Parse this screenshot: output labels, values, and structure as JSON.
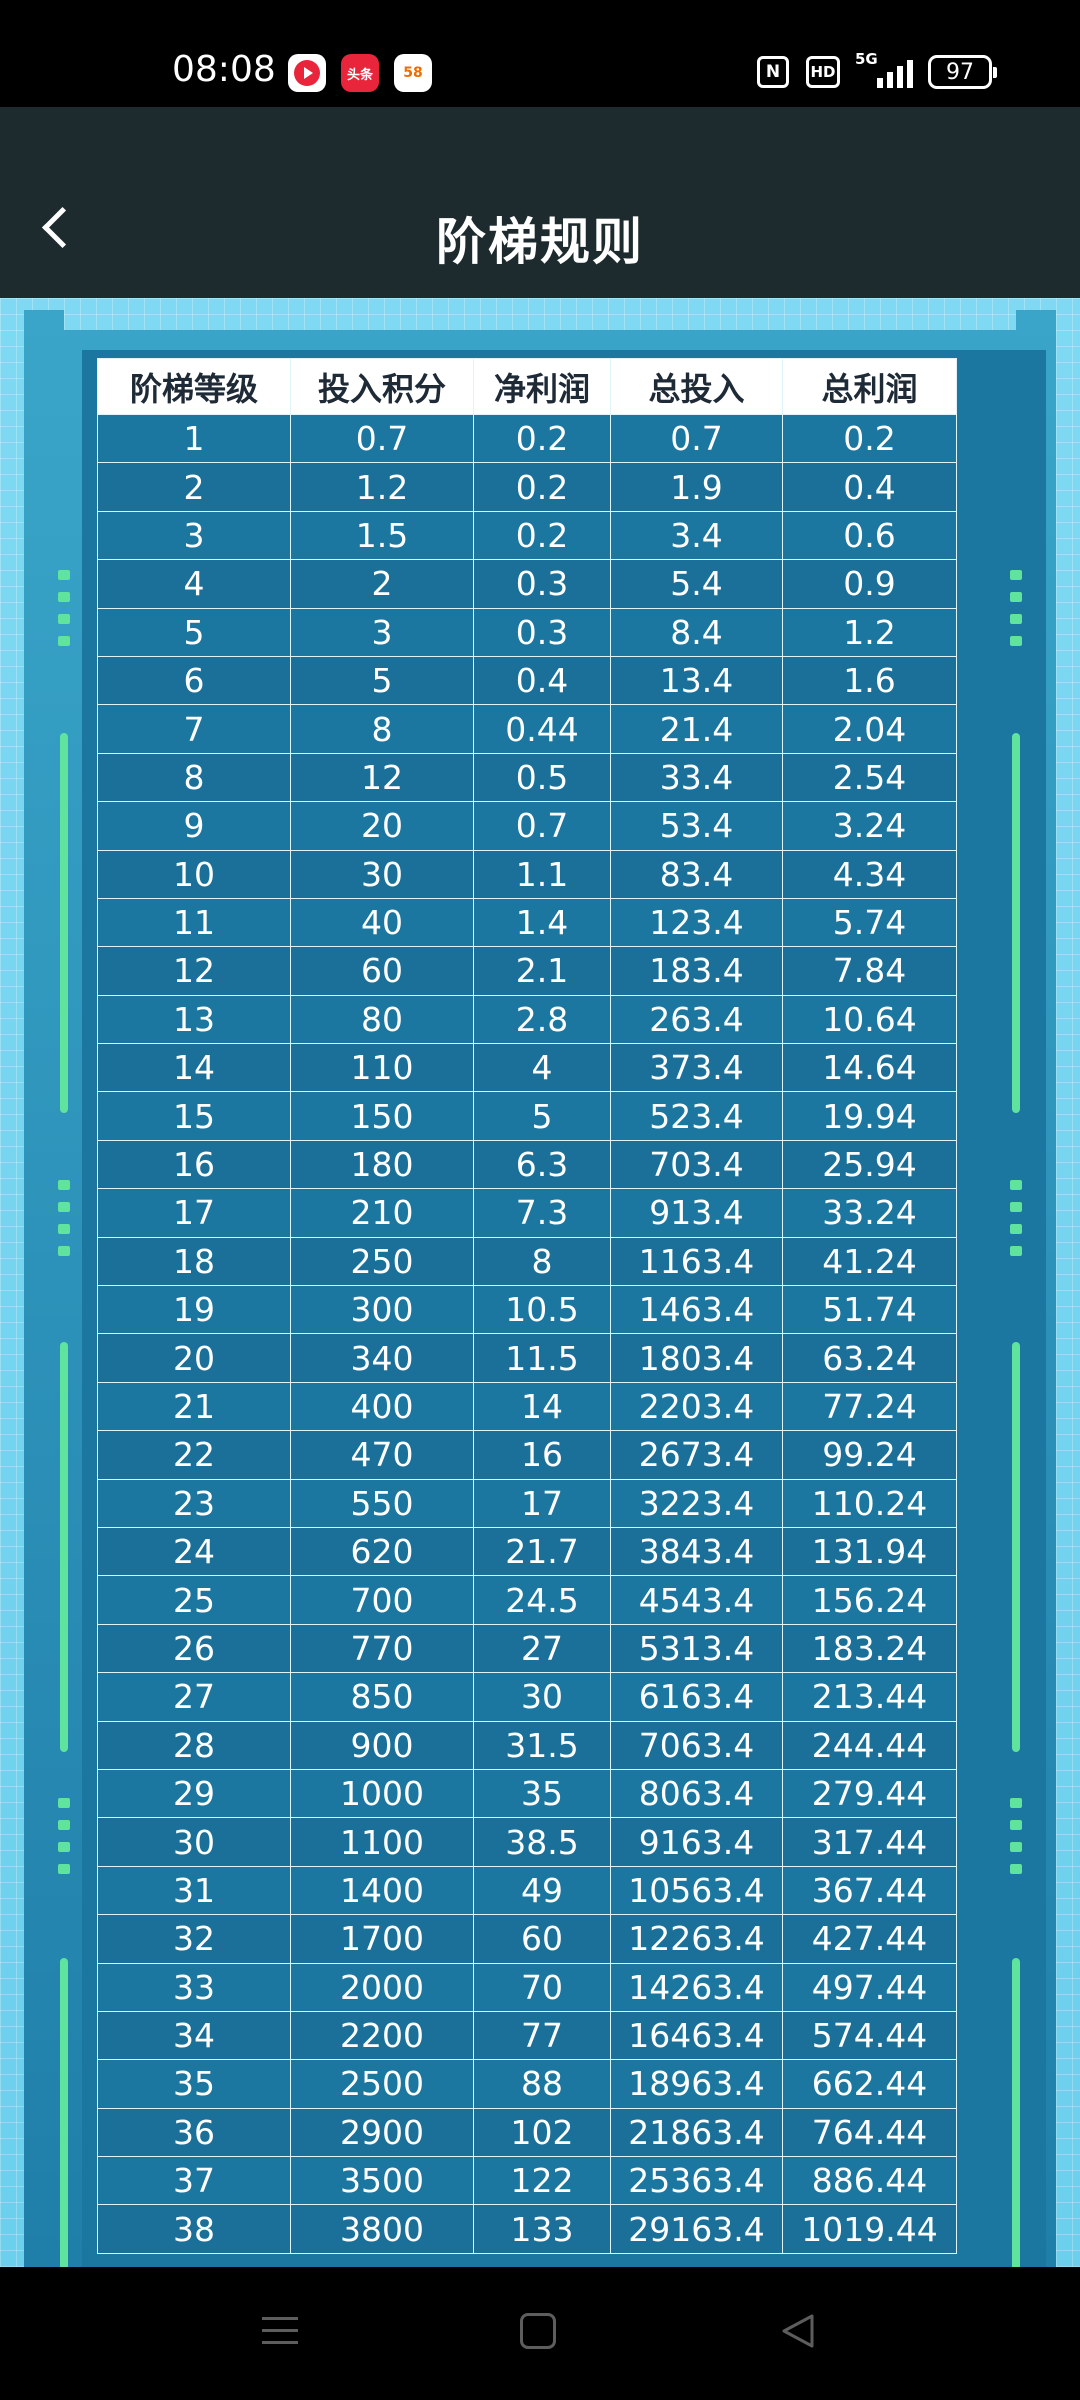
{
  "status_bar": {
    "time": "08:08",
    "notification_icons": [
      "video-app-icon",
      "toutiao-app-icon",
      "58-app-icon"
    ],
    "notif_2_text": "头条",
    "notif_3_text": "58",
    "nfc_text": "N",
    "hd_text": "HD",
    "network_text": "5G",
    "battery": "97"
  },
  "header": {
    "title": "阶梯规则",
    "back_icon": "chevron-left-icon"
  },
  "table": {
    "columns": [
      "阶梯等级",
      "投入积分",
      "净利润",
      "总投入",
      "总利润"
    ],
    "rows": [
      [
        "1",
        "0.7",
        "0.2",
        "0.7",
        "0.2"
      ],
      [
        "2",
        "1.2",
        "0.2",
        "1.9",
        "0.4"
      ],
      [
        "3",
        "1.5",
        "0.2",
        "3.4",
        "0.6"
      ],
      [
        "4",
        "2",
        "0.3",
        "5.4",
        "0.9"
      ],
      [
        "5",
        "3",
        "0.3",
        "8.4",
        "1.2"
      ],
      [
        "6",
        "5",
        "0.4",
        "13.4",
        "1.6"
      ],
      [
        "7",
        "8",
        "0.44",
        "21.4",
        "2.04"
      ],
      [
        "8",
        "12",
        "0.5",
        "33.4",
        "2.54"
      ],
      [
        "9",
        "20",
        "0.7",
        "53.4",
        "3.24"
      ],
      [
        "10",
        "30",
        "1.1",
        "83.4",
        "4.34"
      ],
      [
        "11",
        "40",
        "1.4",
        "123.4",
        "5.74"
      ],
      [
        "12",
        "60",
        "2.1",
        "183.4",
        "7.84"
      ],
      [
        "13",
        "80",
        "2.8",
        "263.4",
        "10.64"
      ],
      [
        "14",
        "110",
        "4",
        "373.4",
        "14.64"
      ],
      [
        "15",
        "150",
        "5",
        "523.4",
        "19.94"
      ],
      [
        "16",
        "180",
        "6.3",
        "703.4",
        "25.94"
      ],
      [
        "17",
        "210",
        "7.3",
        "913.4",
        "33.24"
      ],
      [
        "18",
        "250",
        "8",
        "1163.4",
        "41.24"
      ],
      [
        "19",
        "300",
        "10.5",
        "1463.4",
        "51.74"
      ],
      [
        "20",
        "340",
        "11.5",
        "1803.4",
        "63.24"
      ],
      [
        "21",
        "400",
        "14",
        "2203.4",
        "77.24"
      ],
      [
        "22",
        "470",
        "16",
        "2673.4",
        "99.24"
      ],
      [
        "23",
        "550",
        "17",
        "3223.4",
        "110.24"
      ],
      [
        "24",
        "620",
        "21.7",
        "3843.4",
        "131.94"
      ],
      [
        "25",
        "700",
        "24.5",
        "4543.4",
        "156.24"
      ],
      [
        "26",
        "770",
        "27",
        "5313.4",
        "183.24"
      ],
      [
        "27",
        "850",
        "30",
        "6163.4",
        "213.44"
      ],
      [
        "28",
        "900",
        "31.5",
        "7063.4",
        "244.44"
      ],
      [
        "29",
        "1000",
        "35",
        "8063.4",
        "279.44"
      ],
      [
        "30",
        "1100",
        "38.5",
        "9163.4",
        "317.44"
      ],
      [
        "31",
        "1400",
        "49",
        "10563.4",
        "367.44"
      ],
      [
        "32",
        "1700",
        "60",
        "12263.4",
        "427.44"
      ],
      [
        "33",
        "2000",
        "70",
        "14263.4",
        "497.44"
      ],
      [
        "34",
        "2200",
        "77",
        "16463.4",
        "574.44"
      ],
      [
        "35",
        "2500",
        "88",
        "18963.4",
        "662.44"
      ],
      [
        "36",
        "2900",
        "102",
        "21863.4",
        "764.44"
      ],
      [
        "37",
        "3500",
        "122",
        "25363.4",
        "886.44"
      ],
      [
        "38",
        "3800",
        "133",
        "29163.4",
        "1019.44"
      ]
    ]
  },
  "nav_bar": {
    "icons": [
      "menu-icon",
      "home-icon",
      "back-icon"
    ]
  },
  "colors": {
    "header_bg": "#1d2b2e",
    "content_bg": "#7fd9f2",
    "table_bg": "#1b77a0",
    "accent_green": "#5fe39d"
  }
}
